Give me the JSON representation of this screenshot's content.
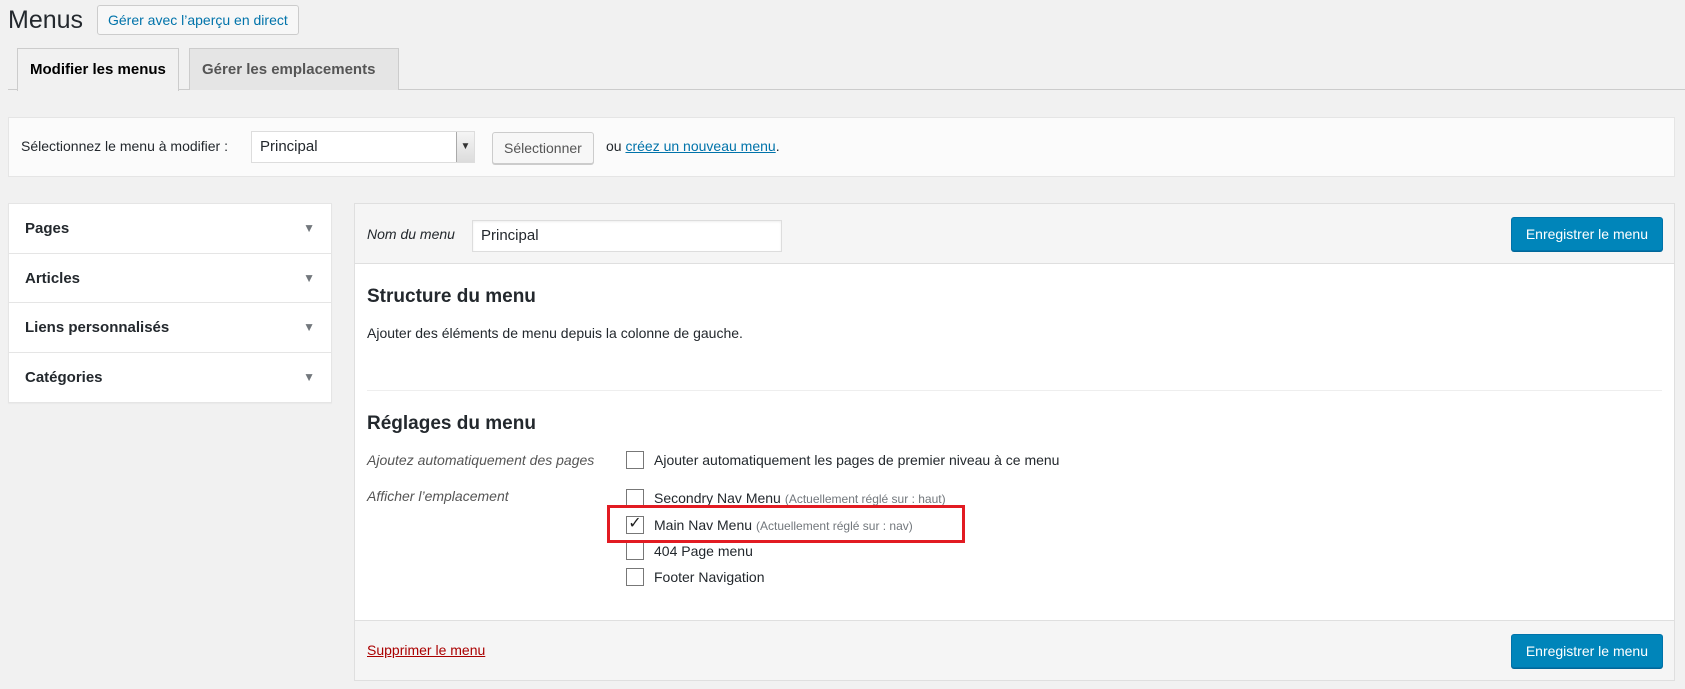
{
  "header": {
    "title": "Menus",
    "live_preview_label": "Gérer avec l’aperçu en direct"
  },
  "tabs": [
    {
      "label": "Modifier les menus",
      "active": true
    },
    {
      "label": "Gérer les emplacements",
      "active": false
    }
  ],
  "select_bar": {
    "label": "Sélectionnez le menu à modifier :",
    "selected_menu": "Principal",
    "select_button": "Sélectionner",
    "or_text": "ou",
    "create_link": "créez un nouveau menu",
    "period": "."
  },
  "sidebar": {
    "items": [
      {
        "label": "Pages"
      },
      {
        "label": "Articles"
      },
      {
        "label": "Liens personnalisés"
      },
      {
        "label": "Catégories"
      }
    ]
  },
  "editor": {
    "name_label": "Nom du menu",
    "name_value": "Principal",
    "save_button": "Enregistrer le menu",
    "structure_title": "Structure du menu",
    "structure_desc": "Ajouter des éléments de menu depuis la colonne de gauche.",
    "settings_title": "Réglages du menu",
    "auto_add_label": "Ajoutez automatiquement des pages",
    "auto_add_option": "Ajouter automatiquement les pages de premier niveau à ce menu",
    "auto_add_checked": false,
    "location_label": "Afficher l’emplacement",
    "locations": [
      {
        "name": "Secondry Nav Menu",
        "note": "(Actuellement réglé sur : haut)",
        "checked": false
      },
      {
        "name": "Main Nav Menu",
        "note": "(Actuellement réglé sur : nav)",
        "checked": true
      },
      {
        "name": "404 Page menu",
        "note": "",
        "checked": false
      },
      {
        "name": "Footer Navigation",
        "note": "",
        "checked": false
      }
    ],
    "delete_link": "Supprimer le menu",
    "save_button_footer": "Enregistrer le menu"
  },
  "colors": {
    "primary": "#0085ba",
    "link": "#0073aa",
    "delete": "#aa0000",
    "highlight": "#e21b22"
  }
}
